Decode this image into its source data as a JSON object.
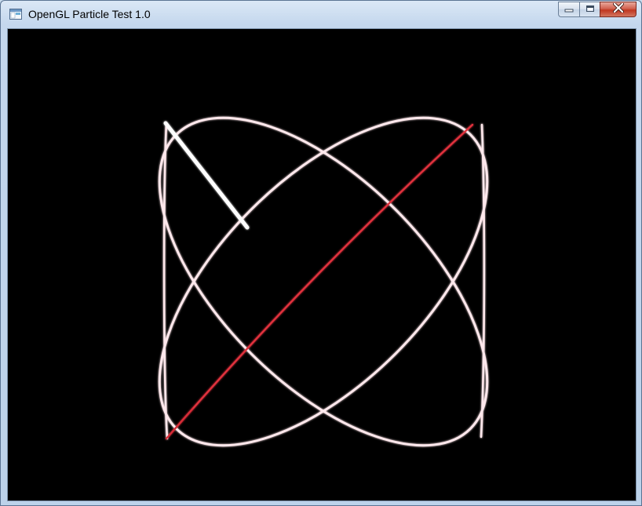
{
  "window": {
    "title": "OpenGL Particle Test 1.0",
    "icon": "app-window-icon",
    "controls": {
      "minimize_icon": "minimize-icon",
      "maximize_icon": "maximize-icon",
      "close_icon": "close-icon"
    }
  },
  "canvas": {
    "background": "#000000",
    "particle_color_white": "#ffe8ec",
    "particle_color_red": "#e0303c"
  }
}
